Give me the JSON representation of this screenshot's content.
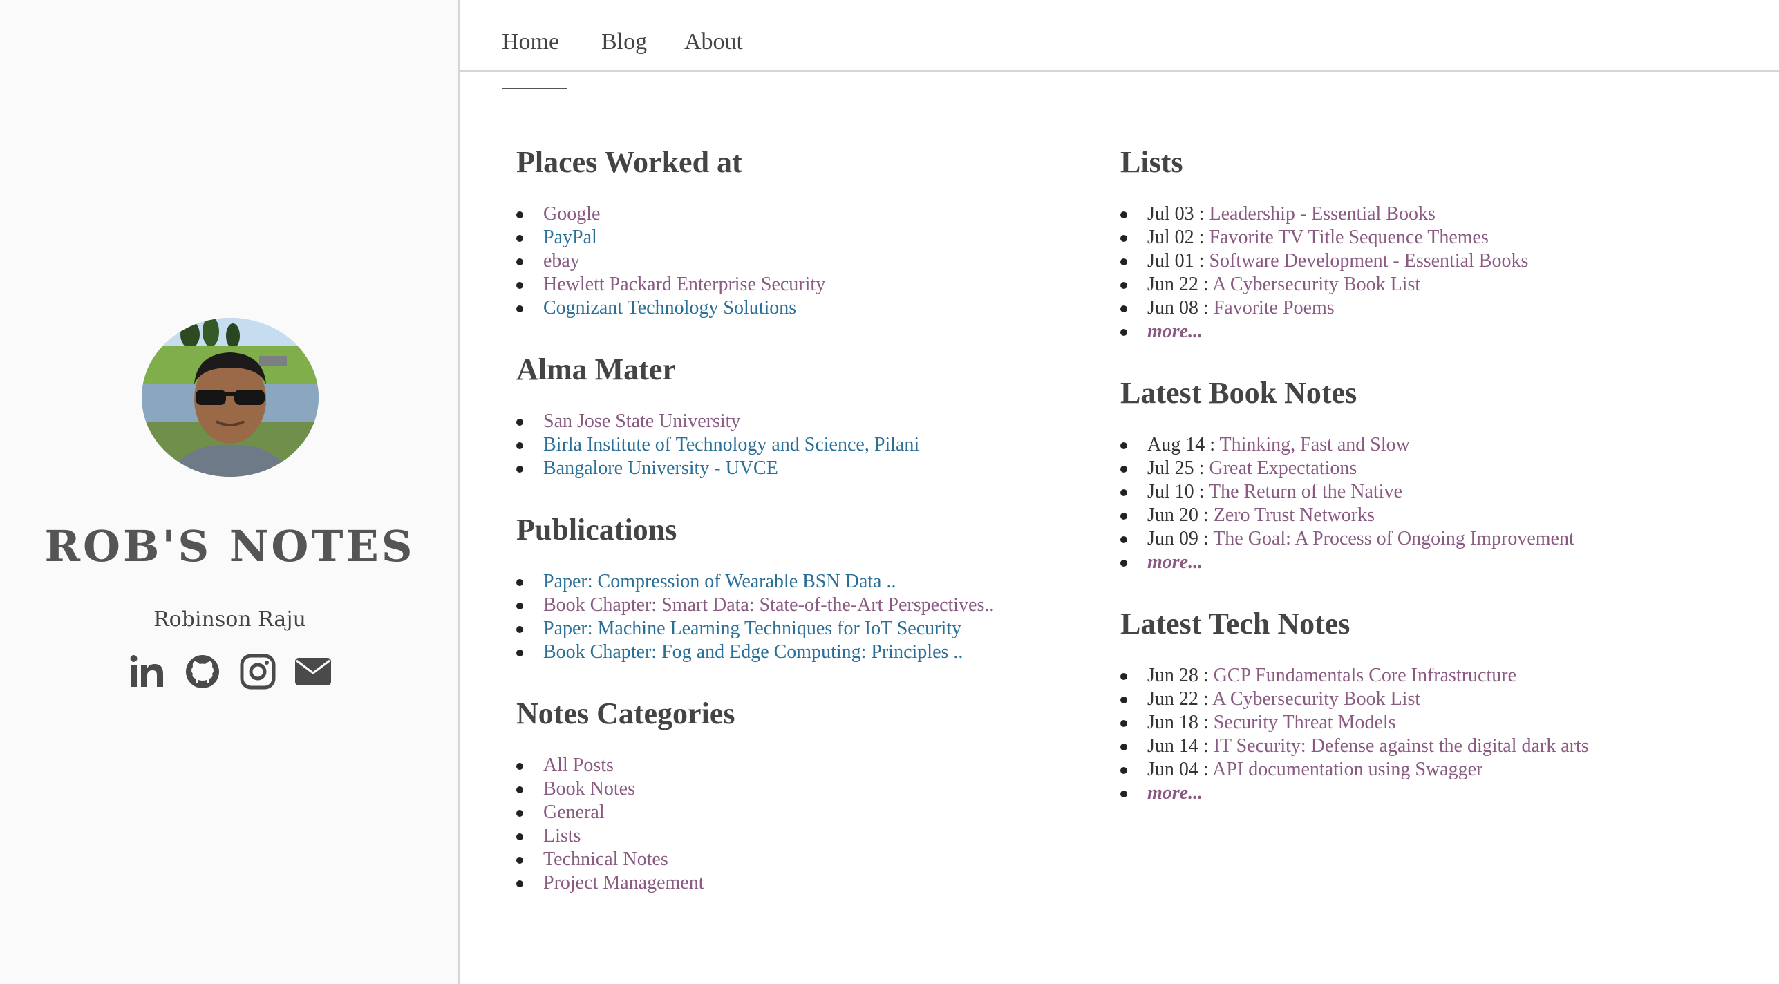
{
  "sidebar": {
    "site_title": "ROB'S NOTES",
    "author": "Robinson Raju",
    "social_icons": [
      "linkedin-icon",
      "github-icon",
      "instagram-icon",
      "envelope-icon"
    ]
  },
  "nav": {
    "items": [
      "Home",
      "Blog",
      "About"
    ],
    "active": "Home"
  },
  "left": {
    "places": {
      "title": "Places Worked at",
      "items": [
        "Google",
        "PayPal",
        "ebay",
        "Hewlett Packard Enterprise Security",
        "Cognizant Technology Solutions"
      ]
    },
    "alma": {
      "title": "Alma Mater",
      "items": [
        "San Jose State University",
        "Birla Institute of Technology and Science, Pilani",
        "Bangalore University - UVCE"
      ]
    },
    "publications": {
      "title": "Publications",
      "items": [
        "Paper: Compression of Wearable BSN Data ..",
        "Book Chapter: Smart Data: State-of-the-Art Perspectives..",
        "Paper: Machine Learning Techniques for IoT Security",
        "Book Chapter: Fog and Edge Computing: Principles .."
      ]
    },
    "categories": {
      "title": "Notes Categories",
      "items": [
        "All Posts",
        "Book Notes",
        "General",
        "Lists",
        "Technical Notes",
        "Project Management"
      ]
    }
  },
  "right": {
    "lists": {
      "title": "Lists",
      "items": [
        {
          "date": "Jul 03 :",
          "title": "Leadership - Essential Books"
        },
        {
          "date": "Jul 02 :",
          "title": "Favorite TV Title Sequence Themes"
        },
        {
          "date": "Jul 01 :",
          "title": "Software Development - Essential Books"
        },
        {
          "date": "Jun 22 :",
          "title": "A Cybersecurity Book List"
        },
        {
          "date": "Jun 08 :",
          "title": "Favorite Poems"
        }
      ],
      "more": "more..."
    },
    "books": {
      "title": "Latest Book Notes",
      "items": [
        {
          "date": "Aug 14 :",
          "title": "Thinking, Fast and Slow"
        },
        {
          "date": "Jul 25 :",
          "title": "Great Expectations"
        },
        {
          "date": "Jul 10 :",
          "title": "The Return of the Native"
        },
        {
          "date": "Jun 20 :",
          "title": "Zero Trust Networks"
        },
        {
          "date": "Jun 09 :",
          "title": "The Goal: A Process of Ongoing Improvement"
        }
      ],
      "more": "more..."
    },
    "tech": {
      "title": "Latest Tech Notes",
      "items": [
        {
          "date": "Jun 28 :",
          "title": "GCP Fundamentals Core Infrastructure"
        },
        {
          "date": "Jun 22 :",
          "title": "A Cybersecurity Book List"
        },
        {
          "date": "Jun 18 :",
          "title": "Security Threat Models"
        },
        {
          "date": "Jun 14 :",
          "title": "IT Security: Defense against the digital dark arts"
        },
        {
          "date": "Jun 04 :",
          "title": "API documentation using Swagger"
        }
      ],
      "more": "more..."
    }
  },
  "colors": {
    "link_purple": "#8a5a82",
    "link_blue": "#2a6f97",
    "heading": "#444444"
  }
}
